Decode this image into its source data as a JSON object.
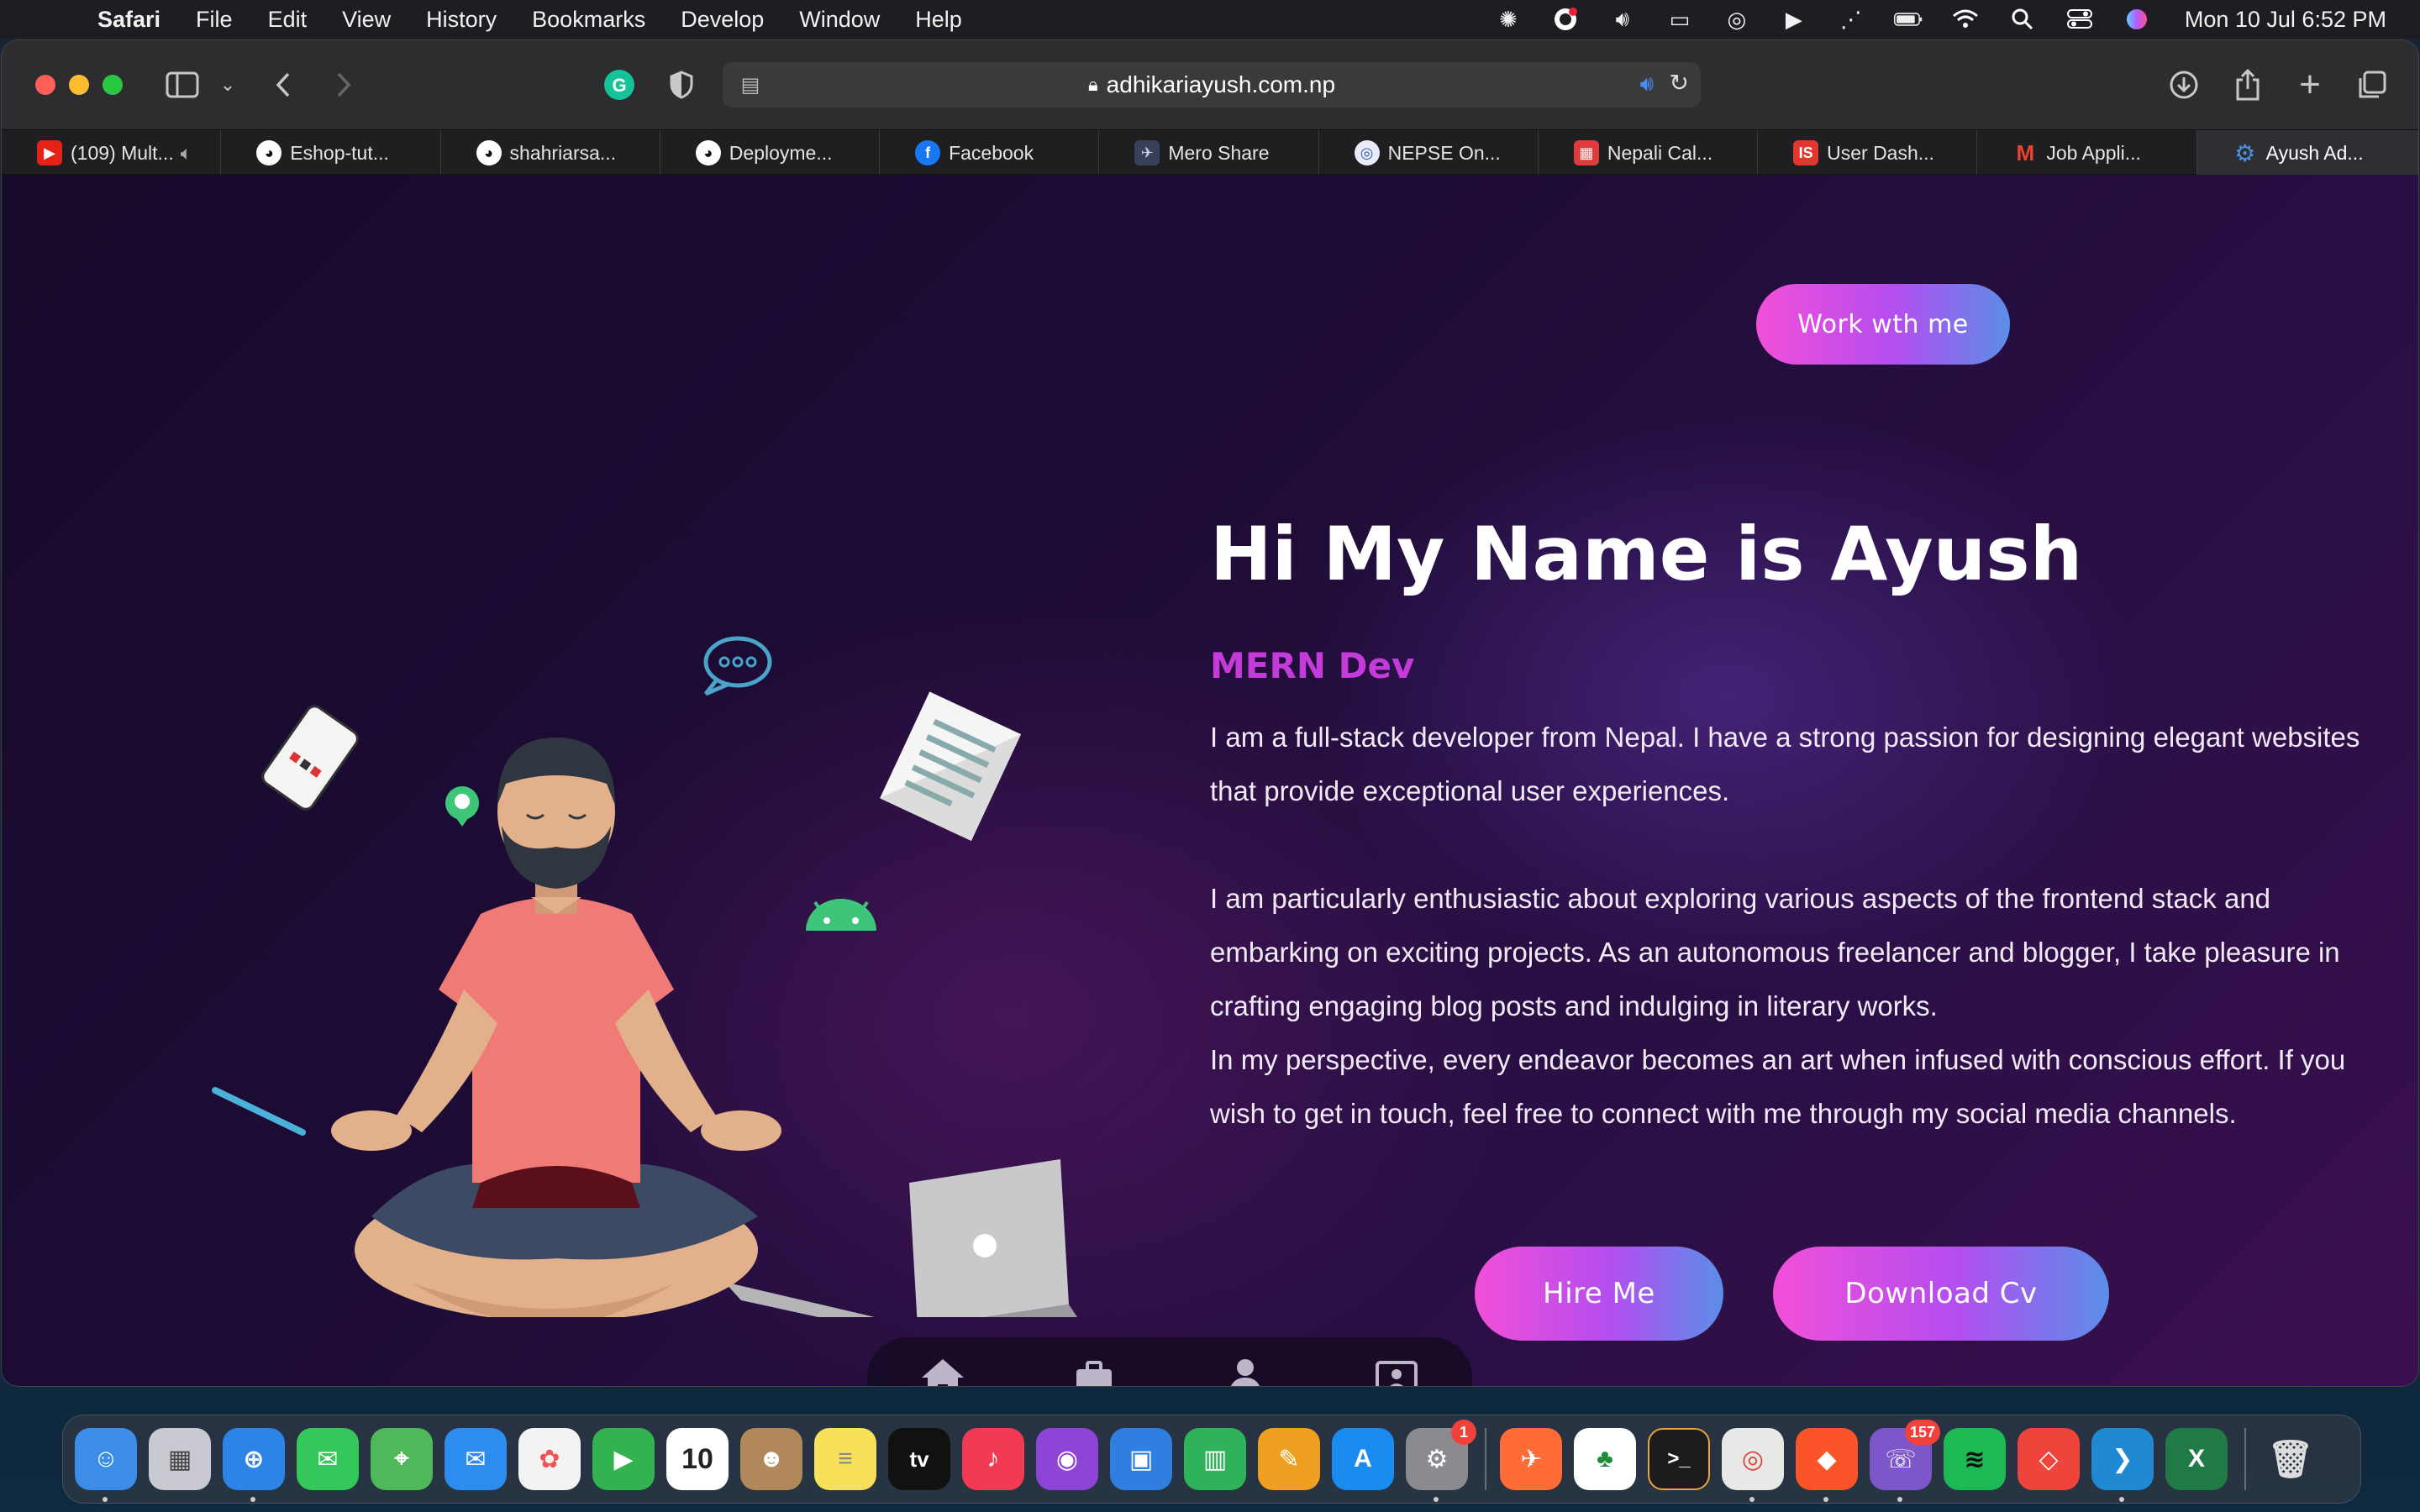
{
  "menubar": {
    "app": "Safari",
    "items": [
      "File",
      "Edit",
      "View",
      "History",
      "Bookmarks",
      "Develop",
      "Window",
      "Help"
    ],
    "clock": "Mon 10 Jul  6:52 PM"
  },
  "browser": {
    "url": "adhikariayush.com.np",
    "tabs": [
      {
        "label": "(109) Mult...",
        "icon": "youtube-icon",
        "color": "#e62117"
      },
      {
        "label": "Eshop-tut...",
        "icon": "github-icon",
        "color": "#ffffff"
      },
      {
        "label": "shahriarsa...",
        "icon": "github-icon",
        "color": "#ffffff"
      },
      {
        "label": "Deployme...",
        "icon": "github-icon",
        "color": "#ffffff"
      },
      {
        "label": "Facebook",
        "icon": "facebook-icon",
        "color": "#1877f2"
      },
      {
        "label": "Mero Share",
        "icon": "meroshare-icon",
        "color": "#6b7da8"
      },
      {
        "label": "NEPSE On...",
        "icon": "nepse-icon",
        "color": "#8fa3d8"
      },
      {
        "label": "Nepali Cal...",
        "icon": "calendar-icon",
        "color": "#e23b3b"
      },
      {
        "label": "User Dash...",
        "icon": "dashboard-icon",
        "color": "#e2372f"
      },
      {
        "label": "Job Appli...",
        "icon": "gmail-icon",
        "color": "#ea4335"
      },
      {
        "label": "Ayush Ad...",
        "icon": "gear-icon",
        "color": "#4a90e2"
      }
    ]
  },
  "page": {
    "work_button": "Work wth me",
    "title": "Hi My Name is Ayush",
    "role": "MERN Dev",
    "paragraphs": [
      "I am a full-stack developer from Nepal. I have a strong passion for designing elegant websites that provide exceptional user experiences.",
      "I am particularly enthusiastic about exploring various aspects of the frontend stack and embarking on exciting projects. As an autonomous freelancer and blogger, I take pleasure in crafting engaging blog posts and indulging in literary works.",
      "In my perspective, every endeavor becomes an art when infused with conscious effort. If you wish to get in touch, feel free to connect with me through my social media channels."
    ],
    "hire_button": "Hire Me",
    "cv_button": "Download Cv",
    "nav": [
      "home-icon",
      "briefcase-icon",
      "user-icon",
      "contact-icon"
    ]
  },
  "dock": {
    "apps": [
      {
        "name": "finder",
        "bg": "#3b8de8",
        "glyph": "☺"
      },
      {
        "name": "launchpad",
        "bg": "#c9c9d2",
        "glyph": "▦"
      },
      {
        "name": "safari",
        "bg": "#2e84e6",
        "glyph": "⊕"
      },
      {
        "name": "messages",
        "bg": "#34c759",
        "glyph": "✉"
      },
      {
        "name": "maps",
        "bg": "#4fb85a",
        "glyph": "⌖"
      },
      {
        "name": "mail",
        "bg": "#2d8cf0",
        "glyph": "✉"
      },
      {
        "name": "photos",
        "bg": "#f3f3f3",
        "glyph": "✿"
      },
      {
        "name": "facetime",
        "bg": "#32b350",
        "glyph": "▶"
      },
      {
        "name": "calendar",
        "bg": "#ffffff",
        "glyph": "10"
      },
      {
        "name": "contacts",
        "bg": "#b0885a",
        "glyph": "☻"
      },
      {
        "name": "notes",
        "bg": "#f7e15a",
        "glyph": "≡"
      },
      {
        "name": "tv",
        "bg": "#111111",
        "glyph": "tv"
      },
      {
        "name": "music",
        "bg": "#f23a55",
        "glyph": "♪"
      },
      {
        "name": "podcasts",
        "bg": "#8e44d6",
        "glyph": "◉"
      },
      {
        "name": "keynote",
        "bg": "#2f7fe0",
        "glyph": "▣"
      },
      {
        "name": "numbers",
        "bg": "#2fb35a",
        "glyph": "▥"
      },
      {
        "name": "pages",
        "bg": "#f0a020",
        "glyph": "✎"
      },
      {
        "name": "app-store",
        "bg": "#1a8cf0",
        "glyph": "A"
      },
      {
        "name": "system-settings",
        "bg": "#8a8a90",
        "glyph": "⚙",
        "badge": "1"
      },
      {
        "name": "postman",
        "bg": "#ff6c37",
        "glyph": "✈"
      },
      {
        "name": "mongodb-compass",
        "bg": "#ffffff",
        "glyph": "♣"
      },
      {
        "name": "terminal",
        "bg": "#1c1c1c",
        "glyph": ">_"
      },
      {
        "name": "chrome",
        "bg": "#e8e8e8",
        "glyph": "◎"
      },
      {
        "name": "brave",
        "bg": "#fb542b",
        "glyph": "◆"
      },
      {
        "name": "viber",
        "bg": "#7d56c9",
        "glyph": "☏",
        "badge": "157"
      },
      {
        "name": "spotify",
        "bg": "#1db954",
        "glyph": "≋"
      },
      {
        "name": "anydesk",
        "bg": "#ef443b",
        "glyph": "◇"
      },
      {
        "name": "vscode",
        "bg": "#1f8ad2",
        "glyph": "❯"
      },
      {
        "name": "excel",
        "bg": "#1f7a45",
        "glyph": "X"
      }
    ],
    "trash": "trash"
  }
}
